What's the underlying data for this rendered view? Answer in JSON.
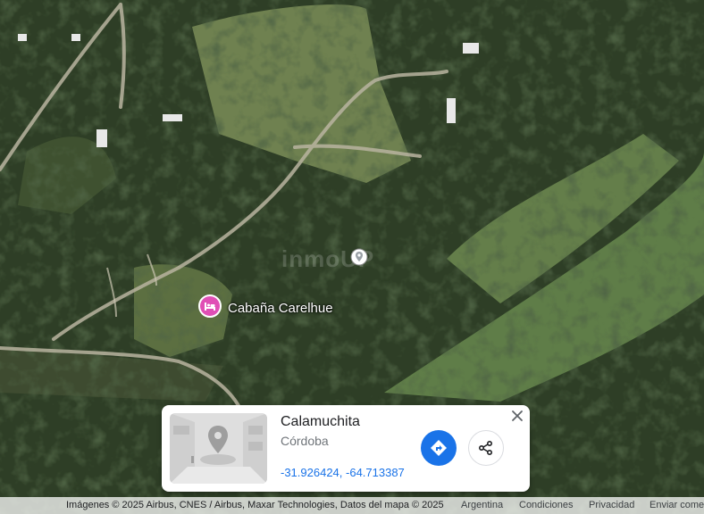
{
  "map": {
    "poi_label": "Cabaña Carelhue",
    "watermark": "inmoUP"
  },
  "info_card": {
    "title": "Calamuchita",
    "subtitle": "Córdoba",
    "coordinates": "-31.926424, -64.713387",
    "icons": {
      "close": "close-icon",
      "directions": "directions-icon",
      "share": "share-icon"
    }
  },
  "footer": {
    "attribution": "Imágenes © 2025 Airbus, CNES / Airbus, Maxar Technologies, Datos del mapa © 2025",
    "country": "Argentina",
    "terms": "Condiciones",
    "privacy": "Privacidad",
    "feedback": "Enviar comentarios"
  },
  "colors": {
    "pin_hotel": "#e04fb5",
    "directions_button": "#1a73e8",
    "link": "#1a73e8"
  }
}
